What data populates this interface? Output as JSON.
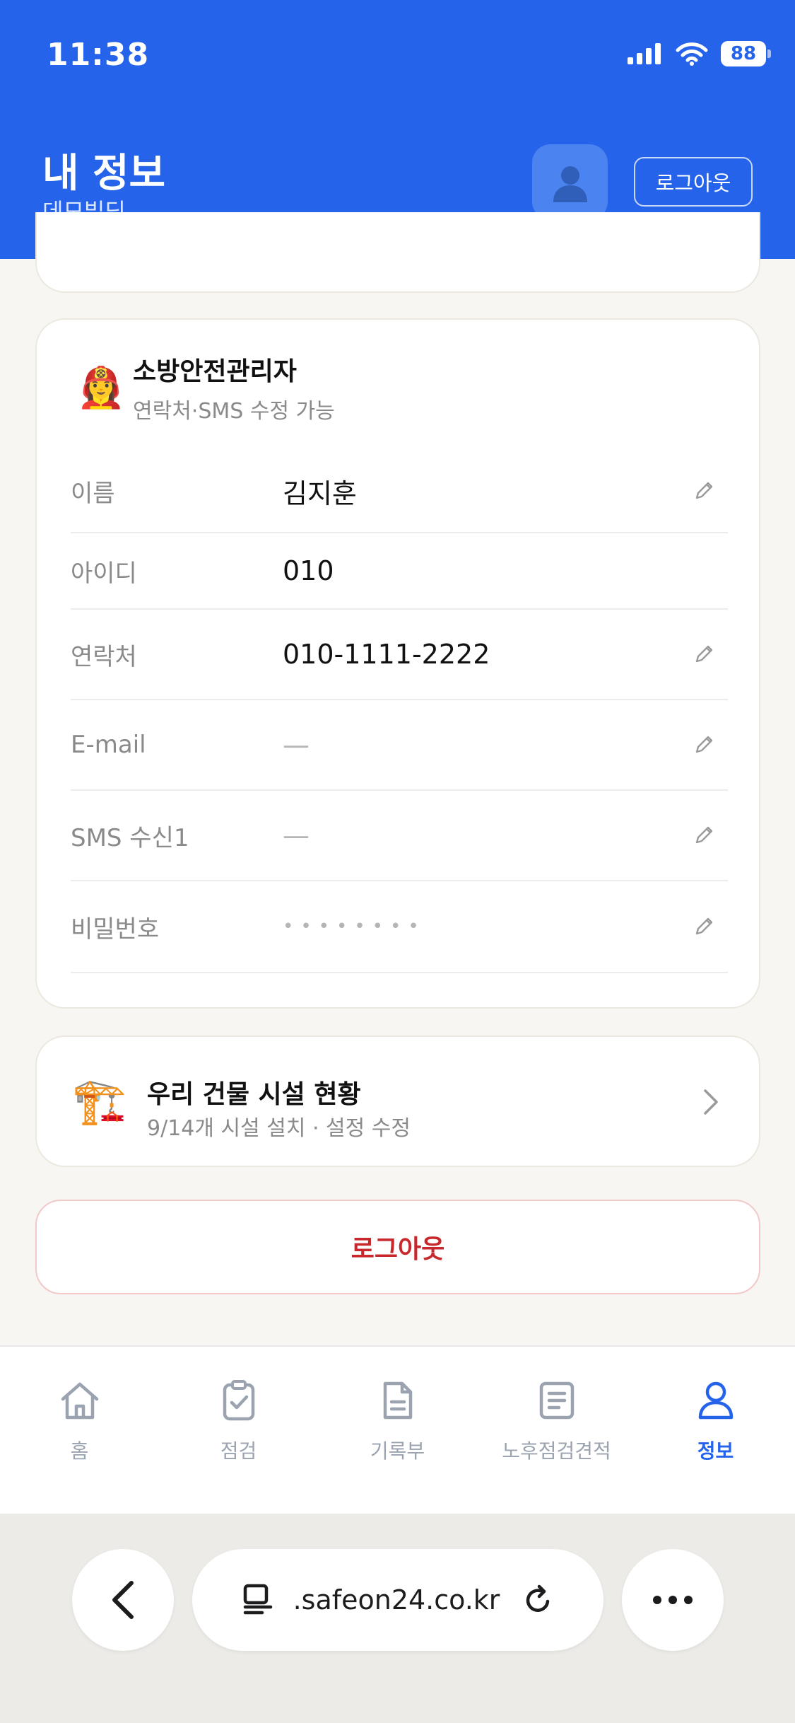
{
  "status_bar": {
    "time": "11:38",
    "battery": "88"
  },
  "header": {
    "title": "내 정보",
    "subtitle": "데모빌딩",
    "logout_label": "로그아웃",
    "bg_color": "#2563eb"
  },
  "profile": {
    "role_emoji": "👩‍🚒",
    "role_title": "소방안전관리자",
    "role_sub": "연락처·SMS 수정 가능",
    "rows": [
      {
        "label": "이름",
        "value": "김지훈"
      },
      {
        "label": "아이디",
        "value": "010"
      },
      {
        "label": "연락처",
        "value": "010-1111-2222"
      },
      {
        "label": "E-mail",
        "value": "—"
      },
      {
        "label": "SMS 수신1",
        "value": "—"
      },
      {
        "label": "비밀번호",
        "value": "••••••••"
      }
    ]
  },
  "facility": {
    "emoji": "🏗️",
    "title": "우리 건물 시설 현황",
    "sub": "9/14개 시설 설치 · 설정 수정"
  },
  "logout_button": {
    "label": "로그아웃",
    "color": "#c8282b"
  },
  "tabs": [
    {
      "label": "홈",
      "icon": "home-icon"
    },
    {
      "label": "점검",
      "icon": "clipboard-check-icon"
    },
    {
      "label": "기록부",
      "icon": "document-icon"
    },
    {
      "label": "노후점검견적",
      "icon": "list-document-icon"
    },
    {
      "label": "정보",
      "icon": "user-icon",
      "active": true
    }
  ],
  "browser": {
    "url": ".safeon24.co.kr"
  }
}
